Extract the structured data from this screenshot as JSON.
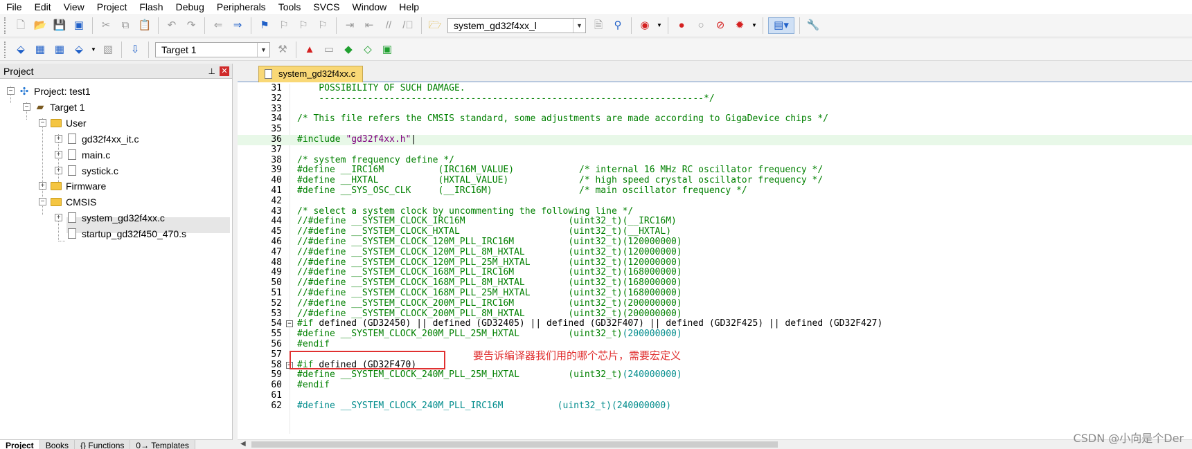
{
  "menu": [
    "File",
    "Edit",
    "View",
    "Project",
    "Flash",
    "Debug",
    "Peripherals",
    "Tools",
    "SVCS",
    "Window",
    "Help"
  ],
  "toolbar1": {
    "file_combo": "system_gd32f4xx_l"
  },
  "toolbar2": {
    "target_combo": "Target 1"
  },
  "project_panel": {
    "title": "Project",
    "tree": {
      "project": "Project: test1",
      "target": "Target 1",
      "group_user": "User",
      "file_it": "gd32f4xx_it.c",
      "file_main": "main.c",
      "file_systick": "systick.c",
      "group_firmware": "Firmware",
      "group_cmsis": "CMSIS",
      "file_system": "system_gd32f4xx.c",
      "file_startup": "startup_gd32f450_470.s"
    },
    "bottom_tabs": [
      "Project",
      "Books",
      "{} Functions",
      "0→ Templates"
    ]
  },
  "editor": {
    "tab_label": "system_gd32f4xx.c",
    "lines": [
      {
        "n": "31",
        "parts": [
          {
            "t": "    POSSIBILITY OF SUCH DAMAGE.",
            "c": "c-cm"
          }
        ]
      },
      {
        "n": "32",
        "parts": [
          {
            "t": "    -----------------------------------------------------------------------*/",
            "c": "c-cm"
          }
        ]
      },
      {
        "n": "33",
        "parts": []
      },
      {
        "n": "34",
        "parts": [
          {
            "t": "/* This file refers the CMSIS standard, some adjustments are made according to GigaDevice chips */",
            "c": "c-cm"
          }
        ]
      },
      {
        "n": "35",
        "parts": []
      },
      {
        "n": "36",
        "parts": [
          {
            "t": "#include ",
            "c": "c-pp"
          },
          {
            "t": "\"gd32f4xx.h\"",
            "c": "c-str"
          },
          {
            "t": "|",
            "c": "c-pl"
          }
        ],
        "cur": true
      },
      {
        "n": "37",
        "parts": []
      },
      {
        "n": "38",
        "parts": [
          {
            "t": "/* system frequency define */",
            "c": "c-cm"
          }
        ]
      },
      {
        "n": "39",
        "parts": [
          {
            "t": "#define __IRC16M          (IRC16M_VALUE)            ",
            "c": "c-pp"
          },
          {
            "t": "/* internal 16 MHz RC oscillator frequency */",
            "c": "c-cm"
          }
        ]
      },
      {
        "n": "40",
        "parts": [
          {
            "t": "#define __HXTAL           (HXTAL_VALUE)             ",
            "c": "c-pp"
          },
          {
            "t": "/* high speed crystal oscillator frequency */",
            "c": "c-cm"
          }
        ]
      },
      {
        "n": "41",
        "parts": [
          {
            "t": "#define __SYS_OSC_CLK     (__IRC16M)                ",
            "c": "c-pp"
          },
          {
            "t": "/* main oscillator frequency */",
            "c": "c-cm"
          }
        ]
      },
      {
        "n": "42",
        "parts": []
      },
      {
        "n": "43",
        "parts": [
          {
            "t": "/* select a system clock by uncommenting the following line */",
            "c": "c-cm"
          }
        ]
      },
      {
        "n": "44",
        "parts": [
          {
            "t": "//#define __SYSTEM_CLOCK_IRC16M                   (uint32_t)(__IRC16M)",
            "c": "c-cm"
          }
        ]
      },
      {
        "n": "45",
        "parts": [
          {
            "t": "//#define __SYSTEM_CLOCK_HXTAL                    (uint32_t)(__HXTAL)",
            "c": "c-cm"
          }
        ]
      },
      {
        "n": "46",
        "parts": [
          {
            "t": "//#define __SYSTEM_CLOCK_120M_PLL_IRC16M          (uint32_t)(120000000)",
            "c": "c-cm"
          }
        ]
      },
      {
        "n": "47",
        "parts": [
          {
            "t": "//#define __SYSTEM_CLOCK_120M_PLL_8M_HXTAL        (uint32_t)(120000000)",
            "c": "c-cm"
          }
        ]
      },
      {
        "n": "48",
        "parts": [
          {
            "t": "//#define __SYSTEM_CLOCK_120M_PLL_25M_HXTAL       (uint32_t)(120000000)",
            "c": "c-cm"
          }
        ]
      },
      {
        "n": "49",
        "parts": [
          {
            "t": "//#define __SYSTEM_CLOCK_168M_PLL_IRC16M          (uint32_t)(168000000)",
            "c": "c-cm"
          }
        ]
      },
      {
        "n": "50",
        "parts": [
          {
            "t": "//#define __SYSTEM_CLOCK_168M_PLL_8M_HXTAL        (uint32_t)(168000000)",
            "c": "c-cm"
          }
        ]
      },
      {
        "n": "51",
        "parts": [
          {
            "t": "//#define __SYSTEM_CLOCK_168M_PLL_25M_HXTAL       (uint32_t)(168000000)",
            "c": "c-cm"
          }
        ]
      },
      {
        "n": "52",
        "parts": [
          {
            "t": "//#define __SYSTEM_CLOCK_200M_PLL_IRC16M          (uint32_t)(200000000)",
            "c": "c-cm"
          }
        ]
      },
      {
        "n": "53",
        "parts": [
          {
            "t": "//#define __SYSTEM_CLOCK_200M_PLL_8M_HXTAL        (uint32_t)(200000000)",
            "c": "c-cm"
          }
        ]
      },
      {
        "n": "54",
        "parts": [
          {
            "t": "#if ",
            "c": "c-pp"
          },
          {
            "t": "defined (GD32450) || defined (GD32405) || defined (GD32F407) || defined (GD32F425) || defined (GD32F427)",
            "c": "c-df"
          }
        ],
        "fold": "−"
      },
      {
        "n": "55",
        "parts": [
          {
            "t": "#define __SYSTEM_CLOCK_200M_PLL_25M_HXTAL         (uint32_t)",
            "c": "c-pp"
          },
          {
            "t": "(200000000)",
            "c": "c-num"
          }
        ]
      },
      {
        "n": "56",
        "parts": [
          {
            "t": "#endif",
            "c": "c-pp"
          }
        ]
      },
      {
        "n": "57",
        "parts": []
      },
      {
        "n": "58",
        "parts": [
          {
            "t": "#if ",
            "c": "c-pp"
          },
          {
            "t": "defined (GD32F470)",
            "c": "c-df"
          }
        ],
        "fold": "−"
      },
      {
        "n": "59",
        "parts": [
          {
            "t": "#define __SYSTEM_CLOCK_240M_PLL_25M_HXTAL         (uint32_t)",
            "c": "c-pp"
          },
          {
            "t": "(240000000)",
            "c": "c-num"
          }
        ]
      },
      {
        "n": "60",
        "parts": [
          {
            "t": "#endif",
            "c": "c-pp"
          }
        ]
      },
      {
        "n": "61",
        "parts": []
      },
      {
        "n": "62",
        "parts": [
          {
            "t": "#define __SYSTEM_CLOCK_240M_PLL_IRC16M          (uint32_t)(240000000)",
            "c": "c-num"
          }
        ]
      }
    ]
  },
  "annotation": {
    "text": "要告诉编译器我们用的哪个芯片，需要宏定义"
  },
  "watermark": "CSDN @小向是个Der"
}
